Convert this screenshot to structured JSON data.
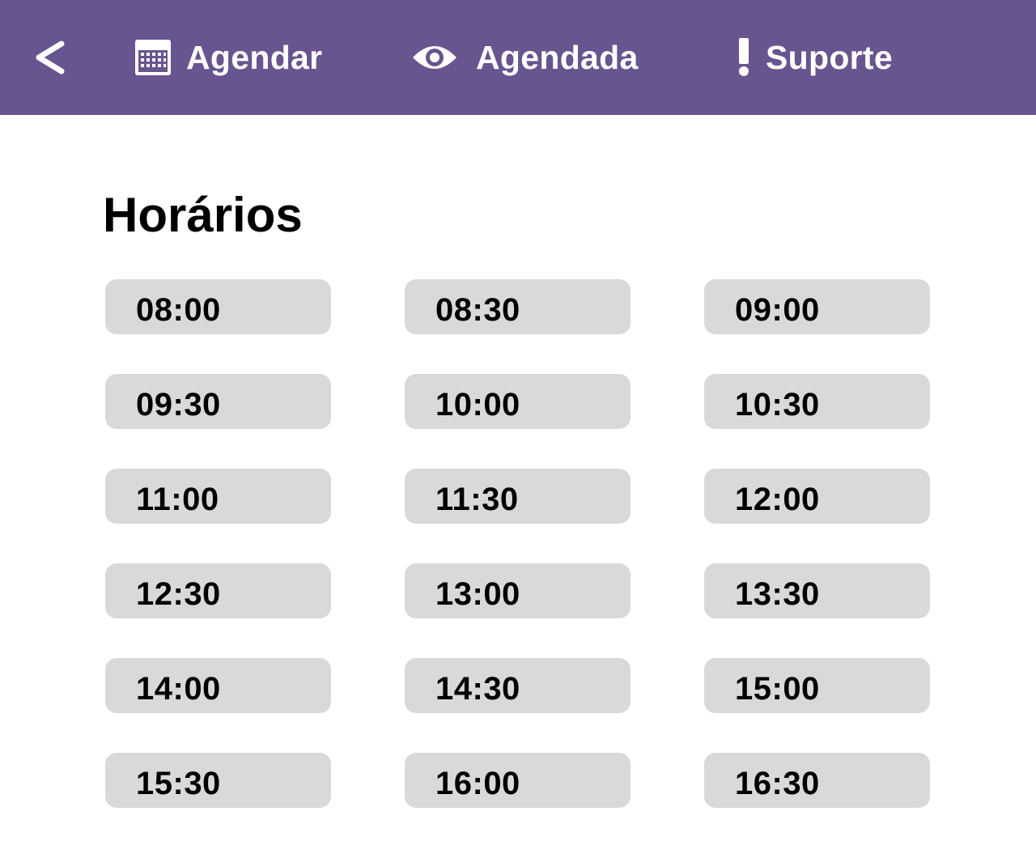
{
  "header": {
    "background_color": "#68548f",
    "back_icon": "chevron-left-icon",
    "nav": [
      {
        "icon": "calendar-icon",
        "label": "Agendar"
      },
      {
        "icon": "eye-icon",
        "label": "Agendada"
      },
      {
        "icon": "exclamation-icon",
        "label": "Suporte"
      }
    ]
  },
  "main": {
    "title": "Horários",
    "slot_color": "#d9d9d9",
    "slots": [
      "08:00",
      "08:30",
      "09:00",
      "09:30",
      "10:00",
      "10:30",
      "11:00",
      "11:30",
      "12:00",
      "12:30",
      "13:00",
      "13:30",
      "14:00",
      "14:30",
      "15:00",
      "15:30",
      "16:00",
      "16:30"
    ]
  }
}
